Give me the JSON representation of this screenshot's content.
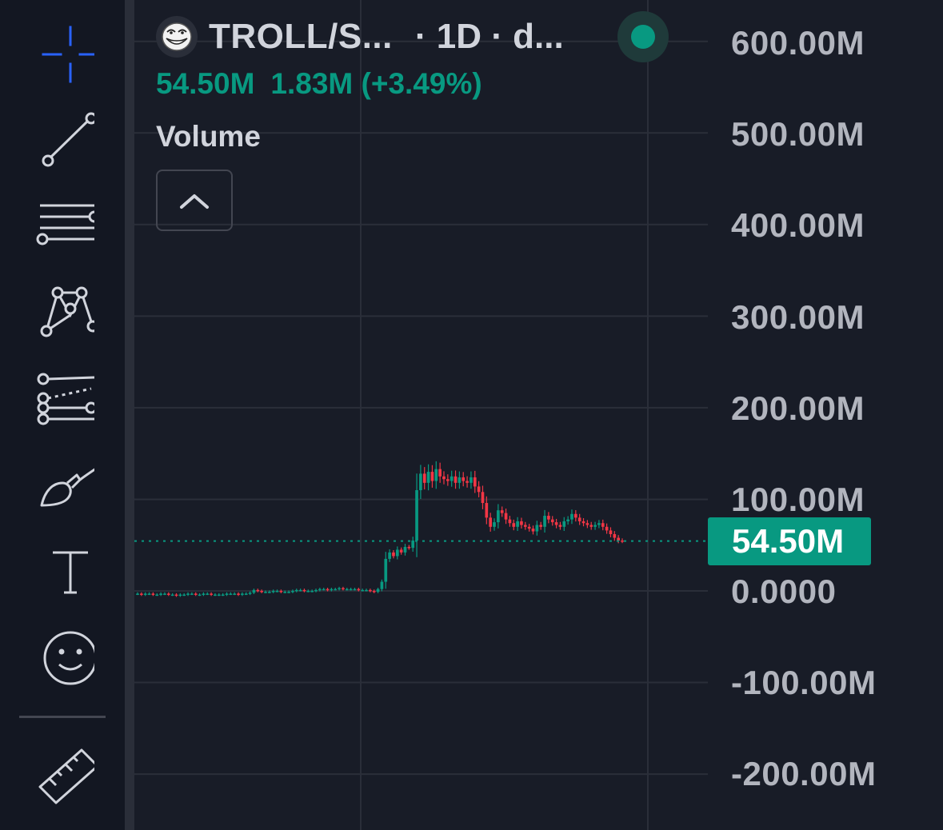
{
  "toolbar": {
    "tools": [
      {
        "icon": "crosshair-icon"
      },
      {
        "icon": "trend-line-icon"
      },
      {
        "icon": "horizontal-lines-icon"
      },
      {
        "icon": "pattern-icon"
      },
      {
        "icon": "fib-tool-icon"
      },
      {
        "icon": "brush-icon"
      },
      {
        "icon": "text-tool-icon"
      },
      {
        "icon": "emoji-icon"
      },
      {
        "icon": "ruler-icon"
      }
    ],
    "active_color": "#2962ff"
  },
  "header": {
    "symbol": "TROLL/S...",
    "interval": "· 1D · d...",
    "logo_icon": "troll-face-icon",
    "status_color": "#089981"
  },
  "legend": {
    "last_value": "54.50M",
    "change": "1.83M (+3.49%)",
    "indicator": "Volume"
  },
  "price_axis": {
    "labels": [
      "600.00M",
      "500.00M",
      "400.00M",
      "300.00M",
      "200.00M",
      "100.00M",
      "0.0000",
      "-100.00M",
      "-200.00M"
    ],
    "last_price": "54.50M"
  },
  "colors": {
    "up": "#089981",
    "down": "#f23645",
    "background": "#181c27",
    "grid": "#2a2e39"
  },
  "chart_data": {
    "type": "candlestick",
    "title": "TROLL/S...",
    "interval": "1D",
    "ylim": [
      -200000000,
      600000000
    ],
    "y_ticks": [
      600000000,
      500000000,
      400000000,
      300000000,
      200000000,
      100000000,
      0,
      -100000000,
      -200000000
    ],
    "last_price": 54500000,
    "change": 1830000,
    "change_pct": 3.49,
    "close_series_millions": [
      -3,
      -4,
      -3,
      -3,
      -4,
      -4,
      -3,
      -3,
      -4,
      -4,
      -5,
      -4,
      -4,
      -3,
      -3,
      -4,
      -4,
      -3,
      -3,
      -4,
      -4,
      -4,
      -4,
      -3,
      -3,
      -3,
      -4,
      -3,
      -3,
      -2,
      1,
      0,
      -1,
      -1,
      -1,
      0,
      0,
      -1,
      -1,
      -1,
      0,
      1,
      1,
      0,
      0,
      0,
      1,
      2,
      2,
      1,
      2,
      2,
      3,
      2,
      2,
      2,
      2,
      1,
      1,
      1,
      0,
      -1,
      2,
      10,
      35,
      42,
      38,
      45,
      42,
      48,
      47,
      55,
      110,
      128,
      118,
      130,
      120,
      133,
      125,
      122,
      120,
      125,
      118,
      124,
      120,
      118,
      124,
      114,
      108,
      96,
      80,
      70,
      75,
      88,
      85,
      78,
      74,
      70,
      76,
      72,
      70,
      68,
      65,
      72,
      70,
      82,
      78,
      75,
      72,
      70,
      76,
      78,
      84,
      80,
      76,
      74,
      72,
      70,
      72,
      74,
      70,
      66,
      62,
      58,
      55,
      54.5
    ]
  }
}
